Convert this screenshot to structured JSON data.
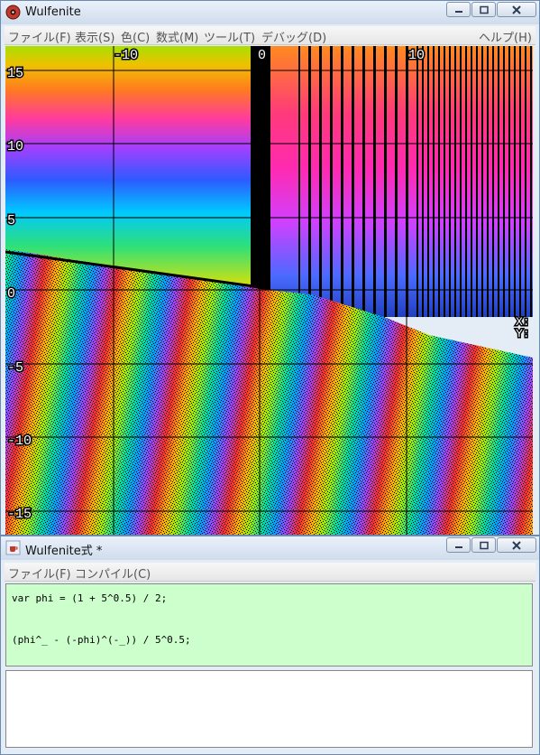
{
  "main_window": {
    "title": "Wulfenite",
    "menu": [
      "ファイル(F)",
      "表示(S)",
      "色(C)",
      "数式(M)",
      "ツール(T)",
      "デバッグ(D)"
    ],
    "help": "ヘルプ(H)"
  },
  "plot": {
    "x_ticks": [
      "-10",
      "0",
      "10"
    ],
    "y_ticks": [
      "15",
      "10",
      "5",
      "0",
      "-5",
      "-10",
      "-15"
    ],
    "cursor_x": "X:",
    "cursor_y": "Y:"
  },
  "expr_window": {
    "title": "Wulfenite式 *",
    "menu": [
      "ファイル(F)",
      "コンパイル(C)"
    ],
    "code_lines": [
      "var phi = (1 + 5^0.5) / 2;",
      "(phi^_ - (-phi)^(-_)) / 5^0.5;"
    ]
  },
  "colors": {
    "editor_bg": "#ccffcc",
    "icon": "#c0392b"
  }
}
